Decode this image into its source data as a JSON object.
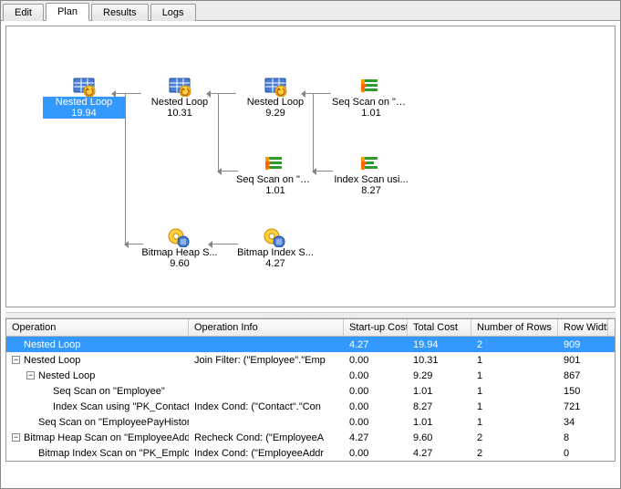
{
  "tabs": [
    "Edit",
    "Plan",
    "Results",
    "Logs"
  ],
  "active_tab": 1,
  "nodes": {
    "n0": {
      "label": "Nested Loop",
      "cost": "19.94",
      "icon": "nested-loop",
      "selected": true
    },
    "n1": {
      "label": "Nested Loop",
      "cost": "10.31",
      "icon": "nested-loop"
    },
    "n2": {
      "label": "Nested Loop",
      "cost": "9.29",
      "icon": "nested-loop"
    },
    "n3": {
      "label": "Seq Scan on \"E...",
      "cost": "1.01",
      "icon": "seq-scan"
    },
    "n4": {
      "label": "Seq Scan on \"E...",
      "cost": "1.01",
      "icon": "seq-scan"
    },
    "n5": {
      "label": "Index Scan usi...",
      "cost": "8.27",
      "icon": "index-scan"
    },
    "n6": {
      "label": "Bitmap Heap S...",
      "cost": "9.60",
      "icon": "bitmap-op"
    },
    "n7": {
      "label": "Bitmap Index S...",
      "cost": "4.27",
      "icon": "bitmap-op"
    }
  },
  "grid": {
    "headers": [
      "Operation",
      "Operation Info",
      "Start-up Cost",
      "Total Cost",
      "Number of Rows",
      "Row Width"
    ],
    "rows": [
      {
        "indent": 0,
        "toggle": "",
        "op": "Nested Loop",
        "info": "",
        "su": "4.27",
        "tc": "19.94",
        "nr": "2",
        "rw": "909",
        "selected": true
      },
      {
        "indent": 0,
        "toggle": "minus",
        "op": "Nested Loop",
        "info": "Join Filter: (\"Employee\".\"Emp",
        "su": "0.00",
        "tc": "10.31",
        "nr": "1",
        "rw": "901"
      },
      {
        "indent": 1,
        "toggle": "minus",
        "op": "Nested Loop",
        "info": "",
        "su": "0.00",
        "tc": "9.29",
        "nr": "1",
        "rw": "867"
      },
      {
        "indent": 2,
        "toggle": "",
        "op": "Seq Scan on \"Employee\"",
        "info": "",
        "su": "0.00",
        "tc": "1.01",
        "nr": "1",
        "rw": "150"
      },
      {
        "indent": 2,
        "toggle": "",
        "op": "Index Scan using \"PK_Contact_",
        "info": "Index Cond: (\"Contact\".\"Con",
        "su": "0.00",
        "tc": "8.27",
        "nr": "1",
        "rw": "721"
      },
      {
        "indent": 1,
        "toggle": "",
        "op": "Seq Scan on \"EmployeePayHistory",
        "info": "",
        "su": "0.00",
        "tc": "1.01",
        "nr": "1",
        "rw": "34"
      },
      {
        "indent": 0,
        "toggle": "minus",
        "op": "Bitmap Heap Scan on \"EmployeeAddr",
        "info": "Recheck Cond: (\"EmployeeA",
        "su": "4.27",
        "tc": "9.60",
        "nr": "2",
        "rw": "8"
      },
      {
        "indent": 1,
        "toggle": "",
        "op": "Bitmap Index Scan on \"PK_Employ",
        "info": "Index Cond: (\"EmployeeAddr",
        "su": "0.00",
        "tc": "4.27",
        "nr": "2",
        "rw": "0"
      }
    ]
  }
}
